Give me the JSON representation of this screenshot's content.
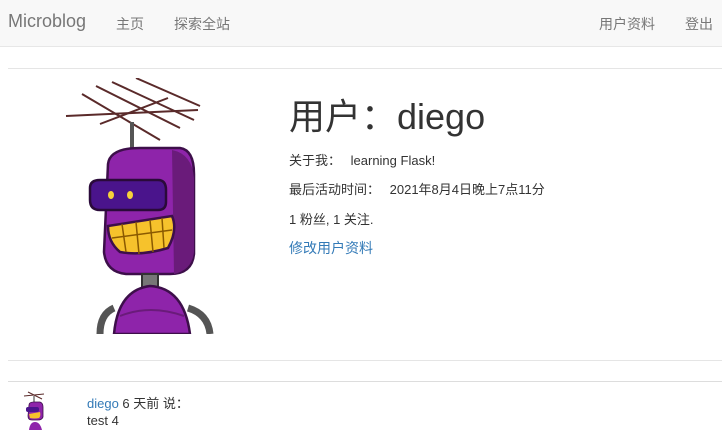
{
  "nav": {
    "brand": "Microblog",
    "home": "主页",
    "explore": "探索全站",
    "profile": "用户资料",
    "logout": "登出"
  },
  "user": {
    "heading": "用户：diego",
    "about_label": "关于我：",
    "about_value": "learning Flask!",
    "last_seen_label": "最后活动时间：",
    "last_seen_value": "2021年8月4日晚上7点11分",
    "follow_stats": "1 粉丝, 1 关注.",
    "edit_link": "修改用户资料"
  },
  "posts": [
    {
      "author": "diego",
      "meta": " 6 天前 说：",
      "body": "test 4"
    }
  ],
  "colors": {
    "link": "#337ab7",
    "navbar_bg": "#f8f8f8",
    "robot_body": "#8e24aa"
  },
  "icons": {
    "avatar": "robot-avatar-icon"
  }
}
